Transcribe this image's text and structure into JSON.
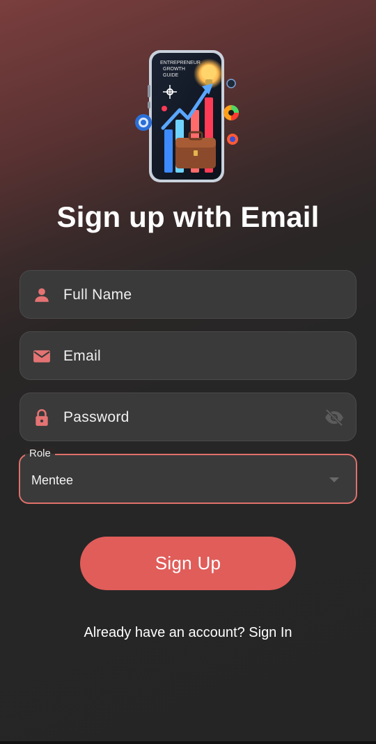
{
  "logo": {
    "caption": "ENTREPRENEUR GROWTH GUIDE"
  },
  "page_title": "Sign up with Email",
  "form": {
    "full_name_placeholder": "Full Name",
    "email_placeholder": "Email",
    "password_placeholder": "Password",
    "role": {
      "label": "Role",
      "selected": "Mentee"
    }
  },
  "signup_button_label": "Sign Up",
  "signin_prompt": "Already have an account? Sign In",
  "colors": {
    "accent": "#e05d5a",
    "icon": "#e57373",
    "field_bg": "#3a3a3a",
    "page_bg": "#252525"
  },
  "icons": {
    "full_name": "person-icon",
    "email": "mail-icon",
    "password": "lock-icon",
    "visibility": "eye-off-icon",
    "dropdown": "caret-down-icon"
  }
}
